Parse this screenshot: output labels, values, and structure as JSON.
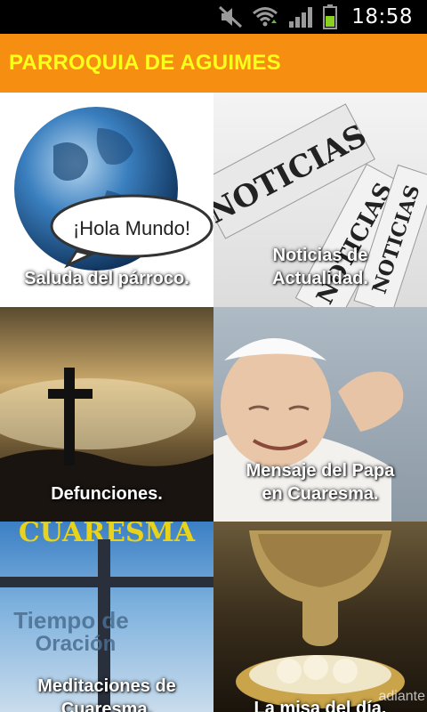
{
  "status_bar": {
    "time": "18:58",
    "icons": [
      "mute-icon",
      "wifi-icon",
      "signal-icon",
      "battery-icon"
    ]
  },
  "app_bar": {
    "title": "PARROQUIA DE AGUIMES",
    "background": "#f68e12",
    "title_color": "#f8ff1a"
  },
  "tiles": [
    {
      "line1": "Saluda del párroco.",
      "line2": "",
      "image": "globe-hola-mundo",
      "bubble_text": "¡Hola Mundo!"
    },
    {
      "line1": "Noticias de",
      "line2": "Actualidad.",
      "image": "newspapers-noticias",
      "paper_text": "NOTICIAS"
    },
    {
      "line1": "Defunciones.",
      "line2": "",
      "image": "cross-sunset"
    },
    {
      "line1": "Mensaje del Papa",
      "line2": "en Cuaresma.",
      "image": "pope-portrait"
    },
    {
      "line1": "Meditaciones de",
      "line2": "Cuaresma.",
      "image": "cuaresma-cross",
      "banner_text": "CUARESMA",
      "overlay_line1": "Tiempo de",
      "overlay_line2": "Oración"
    },
    {
      "line1": "La misa del día.",
      "line2": "",
      "image": "chalice-hosts"
    }
  ],
  "watermark": "adiante"
}
